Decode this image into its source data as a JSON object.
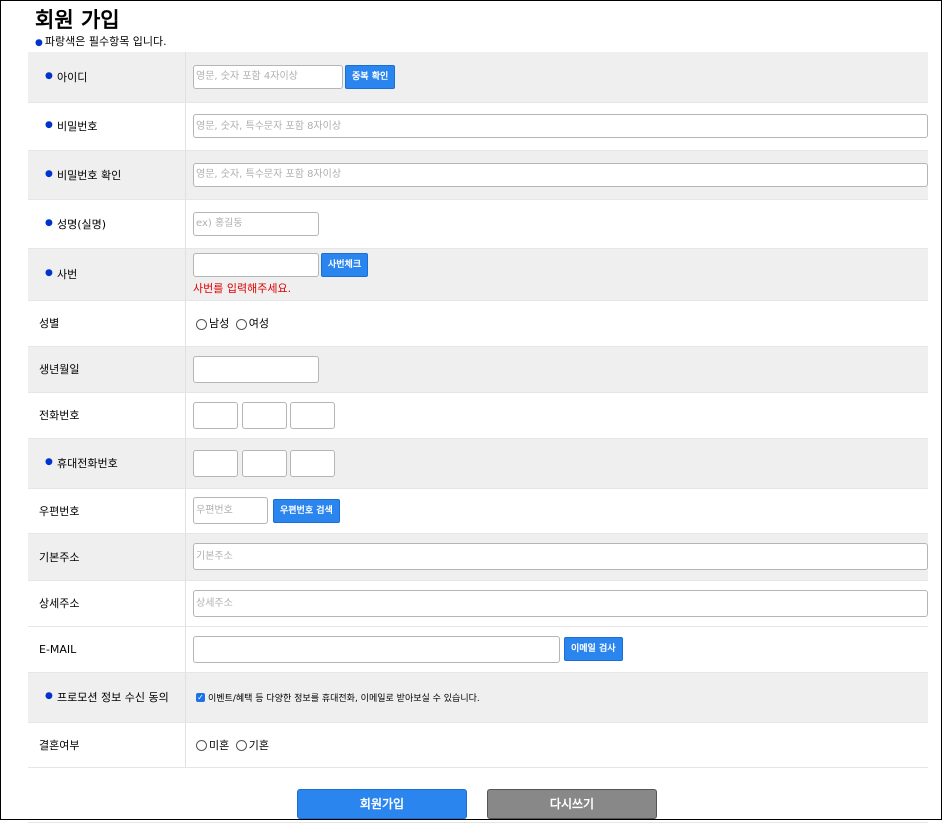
{
  "page": {
    "title": "회원 가입",
    "required_note": "파랑색은 필수항목 입니다."
  },
  "fields": {
    "id": {
      "label": "아이디",
      "placeholder": "영문, 숫자 포함 4자이상",
      "button": "중복 확인"
    },
    "password": {
      "label": "비밀번호",
      "placeholder": "영문, 숫자, 특수문자 포함 8자이상"
    },
    "password_confirm": {
      "label": "비밀번호 확인",
      "placeholder": "영문, 숫자, 특수문자 포함 8자이상"
    },
    "name": {
      "label": "성명(실명)",
      "placeholder": "ex) 홍길동"
    },
    "employee_no": {
      "label": "사번",
      "button": "사번체크",
      "error": "사번를 입력해주세요."
    },
    "gender": {
      "label": "성별",
      "options": [
        "남성",
        "여성"
      ]
    },
    "birth": {
      "label": "생년월일"
    },
    "phone": {
      "label": "전화번호"
    },
    "mobile": {
      "label": "휴대전화번호"
    },
    "zipcode": {
      "label": "우편번호",
      "placeholder": "우편번호",
      "button": "우편번호 검색"
    },
    "address": {
      "label": "기본주소",
      "placeholder": "기본주소"
    },
    "address_detail": {
      "label": "상세주소",
      "placeholder": "상세주소"
    },
    "email": {
      "label": "E-MAIL",
      "button": "이메일 검사"
    },
    "promo": {
      "label": "프로모션 정보 수신 동의",
      "text": "이벤트/혜택 등 다양한 정보를 휴대전화, 이메일로 받아보실 수 있습니다."
    },
    "marital": {
      "label": "결혼여부",
      "options": [
        "미혼",
        "기혼"
      ]
    }
  },
  "buttons": {
    "submit": "회원가입",
    "reset": "다시쓰기"
  },
  "colors": {
    "accent": "#2b85ef",
    "required_dot": "#0033cc",
    "error": "#e00000",
    "row_shade": "#efefef"
  }
}
